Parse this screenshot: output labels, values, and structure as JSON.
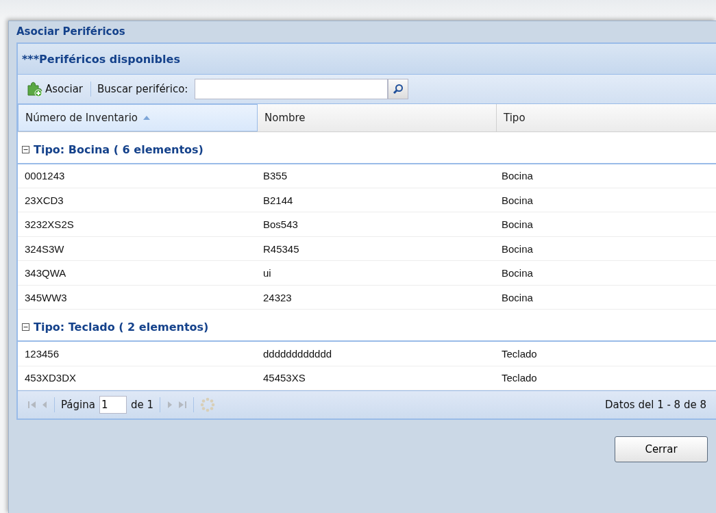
{
  "window": {
    "title": "Asociar Periféricos"
  },
  "panel": {
    "title": "***Periféricos disponibles"
  },
  "toolbar": {
    "associate_button": "Asociar",
    "search_label": "Buscar periférico:"
  },
  "table": {
    "columns": [
      {
        "label": "Número de Inventario",
        "sorted": true
      },
      {
        "label": "Nombre",
        "sorted": false
      },
      {
        "label": "Tipo",
        "sorted": false
      }
    ],
    "groups": [
      {
        "label": "Tipo: Bocina ( 6 elementos)",
        "expanded": true,
        "rows": [
          [
            "0001243",
            "B355",
            "Bocina"
          ],
          [
            "23XCD3",
            "B2144",
            "Bocina"
          ],
          [
            "3232XS2S",
            "Bos543",
            "Bocina"
          ],
          [
            "324S3W",
            "R45345",
            "Bocina"
          ],
          [
            "343QWA",
            "ui",
            "Bocina"
          ],
          [
            "345WW3",
            "24323",
            "Bocina"
          ]
        ]
      },
      {
        "label": "Tipo: Teclado ( 2 elementos)",
        "expanded": true,
        "rows": [
          [
            "123456",
            "dddddddddddd",
            "Teclado"
          ],
          [
            "453XD3DX",
            "45453XS",
            "Teclado"
          ]
        ]
      }
    ]
  },
  "pager": {
    "page_label": "Página",
    "page": "1",
    "of_label": "de 1",
    "first_disabled": true,
    "prev_disabled": true,
    "next_disabled": true,
    "last_disabled": true,
    "summary": "Datos del 1 - 8 de 8"
  },
  "buttons": [
    "Cerrar"
  ]
}
